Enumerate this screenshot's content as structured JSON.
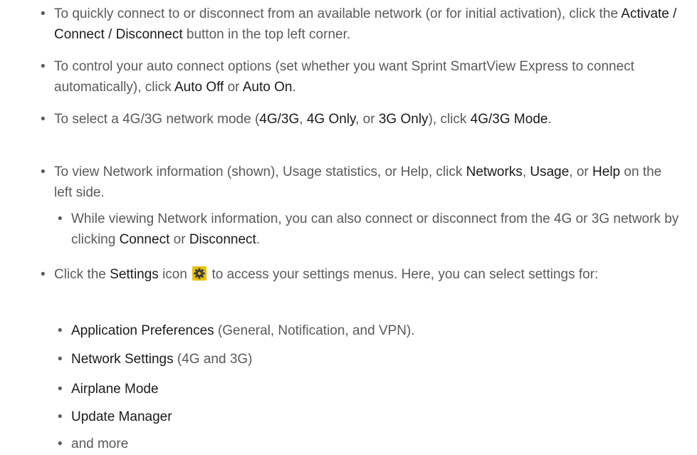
{
  "items": [
    {
      "p1": "To quickly connect to or disconnect from an available network (or for initial activation), click the ",
      "b1": "Activate / Connect / Disconnect",
      "p2": " button in the top left corner."
    },
    {
      "p1": "To control your auto connect options (set whether you want Sprint SmartView Express to connect automatically), click ",
      "b1": "Auto Off",
      "p2": " or ",
      "b2": "Auto On",
      "p3": "."
    },
    {
      "p1": "To select a 4G/3G network mode (",
      "b1": "4G/3G",
      "p2": ", ",
      "b2": "4G Only",
      "p3": ", or ",
      "b3": "3G Only",
      "p4": "), click ",
      "b4": "4G/3G Mode",
      "p5": "."
    },
    {
      "p1": "To view Network information (shown), Usage statistics, or Help, click ",
      "b1": "Networks",
      "p2": ", ",
      "b2": "Usage",
      "p3": ", or ",
      "b3": "Help",
      "p4": " on the left side."
    },
    {
      "p1": "While viewing Network information, you can also connect or disconnect from the 4G or 3G network by clicking ",
      "b1": "Connect",
      "p2": " or ",
      "b2": "Disconnect",
      "p3": "."
    },
    {
      "p1": "Click the ",
      "b1": "Settings",
      "p2": " icon ",
      "p3": " to access your settings menus. Here, you can select settings for:",
      "icon": "settings-gear-icon"
    },
    {
      "b1": "Application Preferences",
      "p1": " (General, Notification, and VPN)."
    },
    {
      "b1": "Network Settings",
      "p1": " (4G and 3G)"
    },
    {
      "b1": "Airplane Mode"
    },
    {
      "b1": "Update Manager"
    },
    {
      "p1": "and more"
    }
  ],
  "colors": {
    "body_text": "#5a5a5a",
    "emphasis_text": "#1a1a1a",
    "icon_bg": "#e8c000",
    "icon_fg": "#3a3a3a"
  }
}
